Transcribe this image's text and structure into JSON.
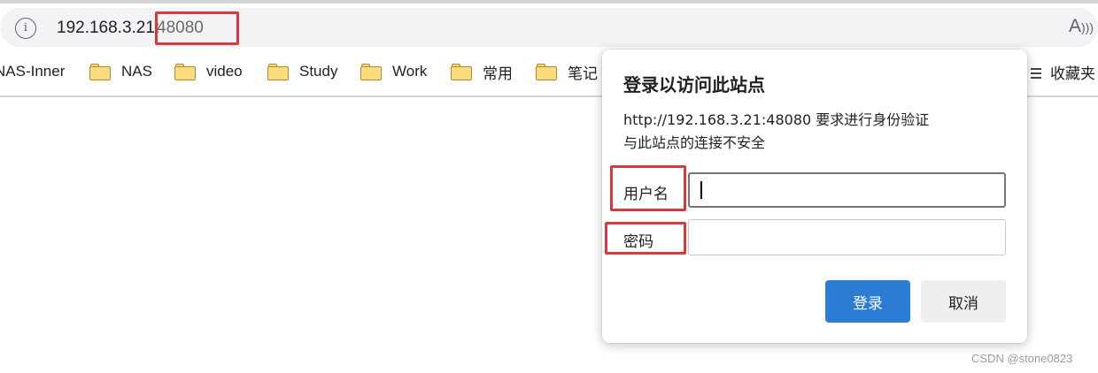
{
  "address_bar": {
    "host": "192.168.3.21:",
    "port": "48080",
    "info_icon_glyph": "i",
    "read_aloud_glyph": "A⁾"
  },
  "bookmarks": [
    {
      "label": "NAS-Inner",
      "icon": "none"
    },
    {
      "label": "NAS",
      "icon": "folder-icon"
    },
    {
      "label": "video",
      "icon": "folder-icon"
    },
    {
      "label": "Study",
      "icon": "folder-icon"
    },
    {
      "label": "Work",
      "icon": "folder-icon"
    },
    {
      "label": "常用",
      "icon": "folder-icon"
    },
    {
      "label": "笔记",
      "icon": "folder-icon"
    },
    {
      "label": "收藏夹",
      "icon": "favorites-icon"
    }
  ],
  "dialog": {
    "title": "登录以访问此站点",
    "message_line1": "http://192.168.3.21:48080 要求进行身份验证",
    "message_line2": "与此站点的连接不安全",
    "username_label": "用户名",
    "password_label": "密码",
    "username_value": "",
    "password_value": "",
    "login_button": "登录",
    "cancel_button": "取消"
  },
  "watermark": "CSDN @stone0823",
  "colors": {
    "highlight": "#d9393c",
    "primary_button": "#2b7cd3",
    "folder": "#fbdc7c"
  }
}
